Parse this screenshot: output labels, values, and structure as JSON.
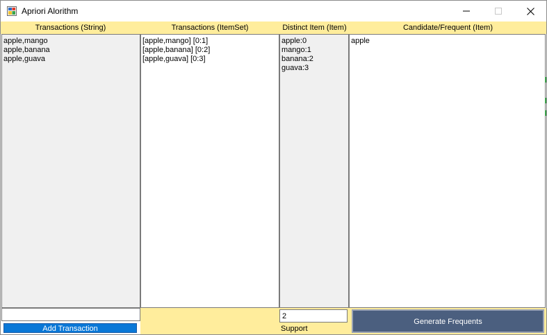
{
  "window": {
    "title": "Apriori Alorithm"
  },
  "headers": {
    "transactions_string": "Transactions (String)",
    "transactions_itemset": "Transactions (ItemSet)",
    "distinct_item": "Distinct Item (Item)",
    "candidate_frequent": "Candidate/Frequent (Item)"
  },
  "transactions_string": [
    "apple,mango",
    "apple,banana",
    "apple,guava"
  ],
  "transactions_itemset": [
    "[apple,mango] [0:1]",
    "[apple,banana] [0:2]",
    "[apple,guava] [0:3]"
  ],
  "distinct_items": [
    "apple:0",
    "mango:1",
    "banana:2",
    "guava:3"
  ],
  "candidate_frequent": [
    "apple"
  ],
  "controls": {
    "transaction_input_value": "",
    "add_transaction_label": "Add Transaction",
    "support_value": "2",
    "support_label": "Support",
    "generate_label": "Generate Frequents"
  },
  "colors": {
    "header_bg": "#ffed9c",
    "add_button": "#0a78d7",
    "generate_button": "#4b5f7f"
  }
}
